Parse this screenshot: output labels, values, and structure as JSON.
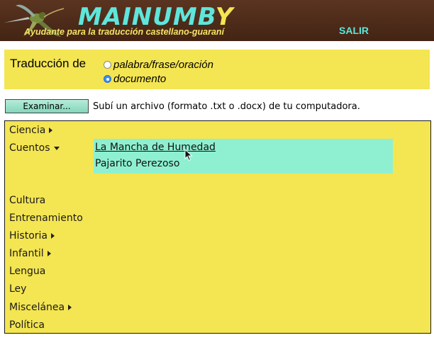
{
  "header": {
    "logo_main": "MAINUMB",
    "logo_accent": "Y",
    "subtitle": "Ayudante para la traducción castellano-guaraní",
    "salir_label": "SALIR",
    "logo_bird_icon": "hummingbird-icon"
  },
  "translation_mode": {
    "label": "Traducción de",
    "options": [
      {
        "label": "palabra/frase/oración",
        "checked": false
      },
      {
        "label": "documento",
        "checked": true
      }
    ]
  },
  "file_upload": {
    "button_label": "Examinar...",
    "hint": "Subí un archivo (formato .txt o .docx) de tu computadora."
  },
  "categories": [
    {
      "label": "Ciencia",
      "indicator": "arrow-right"
    },
    {
      "label": "Cuentos",
      "indicator": "arrow-down"
    },
    {
      "label": "Cultura",
      "indicator": ""
    },
    {
      "label": "Entrenamiento",
      "indicator": ""
    },
    {
      "label": "Historia",
      "indicator": "arrow-right"
    },
    {
      "label": "Infantil",
      "indicator": "arrow-right"
    },
    {
      "label": "Lengua",
      "indicator": ""
    },
    {
      "label": "Ley",
      "indicator": ""
    },
    {
      "label": "Miscelánea",
      "indicator": "arrow-right"
    },
    {
      "label": "Política",
      "indicator": ""
    }
  ],
  "cuentos_submenu": [
    {
      "label": "La Mancha de Humedad",
      "hovered": true
    },
    {
      "label": "Pajarito Perezoso",
      "hovered": false
    }
  ],
  "colors": {
    "header_bg": "#4a2b18",
    "logo_cyan": "#5fe6dc",
    "panel_yellow": "#f4e552",
    "submenu_bg": "#8ef0d0",
    "radio_selected": "#3b8ff0"
  }
}
